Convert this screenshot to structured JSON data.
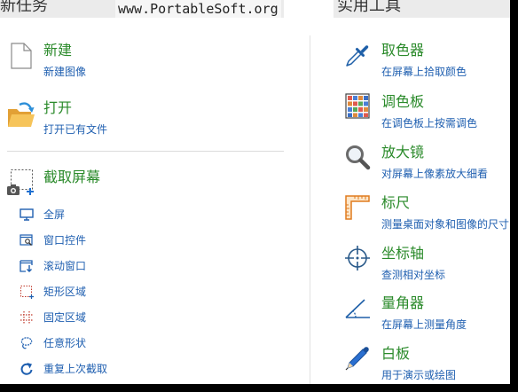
{
  "header": {
    "left_title": "新任务",
    "watermark": "www.PortableSoft.org",
    "right_title": "实用工具"
  },
  "new_task": {
    "items": [
      {
        "title": "新建",
        "subtitle": "新建图像",
        "icon": "new-document-icon"
      },
      {
        "title": "打开",
        "subtitle": "打开已有文件",
        "icon": "open-folder-icon"
      }
    ],
    "capture": {
      "title": "截取屏幕",
      "icon": "screen-capture-icon",
      "options": [
        {
          "label": "全屏",
          "icon": "monitor-icon"
        },
        {
          "label": "窗口控件",
          "icon": "window-control-icon"
        },
        {
          "label": "滚动窗口",
          "icon": "scroll-window-icon"
        },
        {
          "label": "矩形区域",
          "icon": "rectangle-region-icon"
        },
        {
          "label": "固定区域",
          "icon": "fixed-region-icon"
        },
        {
          "label": "任意形状",
          "icon": "freehand-region-icon"
        },
        {
          "label": "重复上次截取",
          "icon": "repeat-icon"
        }
      ]
    }
  },
  "tools": {
    "items": [
      {
        "title": "取色器",
        "subtitle": "在屏幕上拾取颜色",
        "icon": "eyedropper-icon"
      },
      {
        "title": "调色板",
        "subtitle": "在调色板上按需调色",
        "icon": "palette-icon"
      },
      {
        "title": "放大镜",
        "subtitle": "对屏幕上像素放大细看",
        "icon": "magnifier-icon"
      },
      {
        "title": "标尺",
        "subtitle": "测量桌面对象和图像的尺寸",
        "icon": "ruler-icon"
      },
      {
        "title": "坐标轴",
        "subtitle": "查测相对坐标",
        "icon": "crosshair-icon"
      },
      {
        "title": "量角器",
        "subtitle": "在屏幕上测量角度",
        "icon": "protractor-icon"
      },
      {
        "title": "白板",
        "subtitle": "用于演示或绘图",
        "icon": "pen-icon"
      }
    ]
  },
  "colors": {
    "title": "#2a8a2a",
    "subtitle": "#1f5fb0",
    "header_background": "#ebebeb"
  }
}
